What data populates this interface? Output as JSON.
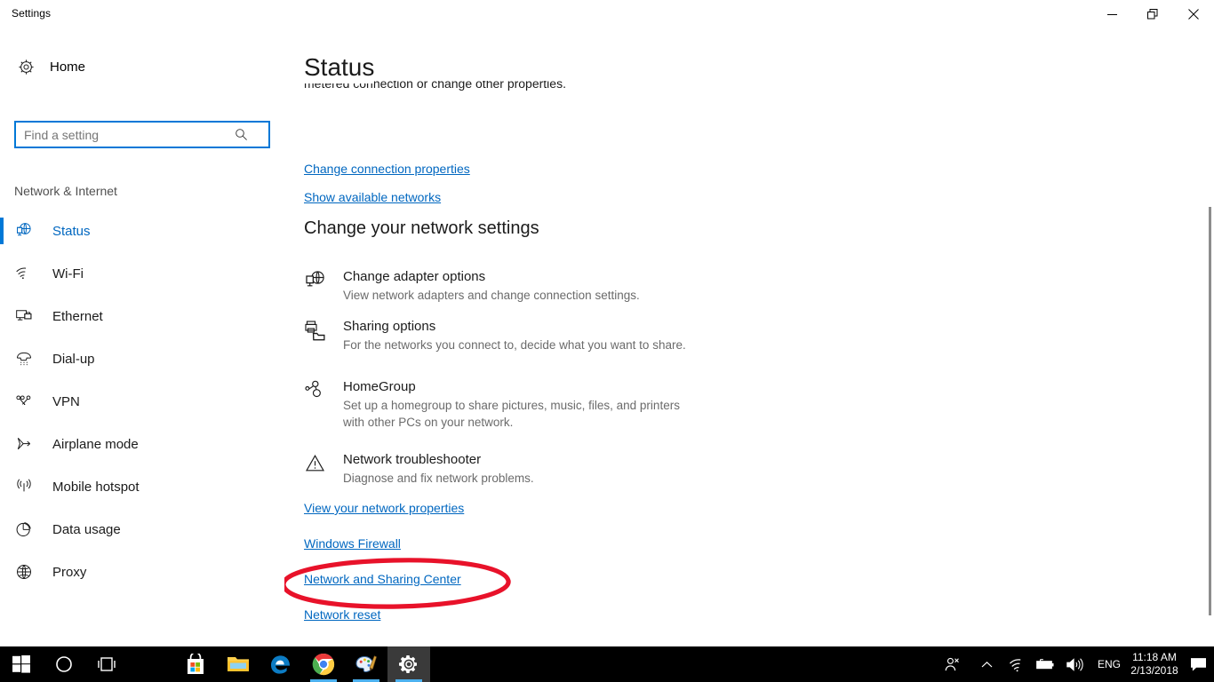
{
  "window": {
    "title": "Settings",
    "controls": {
      "minimize": "Minimize",
      "maximize": "Restore",
      "close": "Close"
    }
  },
  "sidebar": {
    "home_label": "Home",
    "home_icon": "gear-icon",
    "search": {
      "placeholder": "Find a setting",
      "value": "",
      "icon": "search-icon"
    },
    "category_label": "Network & Internet",
    "items": [
      {
        "label": "Status",
        "icon": "network-status-icon",
        "selected": true
      },
      {
        "label": "Wi-Fi",
        "icon": "wifi-icon",
        "selected": false
      },
      {
        "label": "Ethernet",
        "icon": "ethernet-icon",
        "selected": false
      },
      {
        "label": "Dial-up",
        "icon": "dialup-phone-icon",
        "selected": false
      },
      {
        "label": "VPN",
        "icon": "vpn-icon",
        "selected": false
      },
      {
        "label": "Airplane mode",
        "icon": "airplane-icon",
        "selected": false
      },
      {
        "label": "Mobile hotspot",
        "icon": "hotspot-icon",
        "selected": false
      },
      {
        "label": "Data usage",
        "icon": "pie-chart-icon",
        "selected": false
      },
      {
        "label": "Proxy",
        "icon": "globe-icon",
        "selected": false
      }
    ]
  },
  "content": {
    "page_title": "Status",
    "clipped_text": "metered connection or change other properties.",
    "top_links": [
      {
        "label": "Change connection properties"
      },
      {
        "label": "Show available networks"
      }
    ],
    "section_heading": "Change your network settings",
    "settings": [
      {
        "title": "Change adapter options",
        "description": "View network adapters and change connection settings.",
        "icon": "network-adapter-icon"
      },
      {
        "title": "Sharing options",
        "description": "For the networks you connect to, decide what you want to share.",
        "icon": "sharing-printer-folder-icon"
      },
      {
        "title": "HomeGroup",
        "description": "Set up a homegroup to share pictures, music, files, and printers with other PCs on your network.",
        "icon": "homegroup-icon"
      },
      {
        "title": "Network troubleshooter",
        "description": "Diagnose and fix network problems.",
        "icon": "warning-triangle-icon"
      }
    ],
    "bottom_links": [
      {
        "label": "View your network properties"
      },
      {
        "label": "Windows Firewall"
      },
      {
        "label": "Network and Sharing Center",
        "annotated": true
      },
      {
        "label": "Network reset"
      }
    ],
    "annotation": {
      "shape": "red-ellipse-highlight",
      "target": "Network and Sharing Center",
      "color": "#e8122a"
    }
  },
  "taskbar": {
    "items": [
      {
        "name": "start-button",
        "label": "Start",
        "running": false,
        "active": false
      },
      {
        "name": "cortana-button",
        "label": "Cortana",
        "running": false,
        "active": false
      },
      {
        "name": "task-view-button",
        "label": "Task View",
        "running": false,
        "active": false
      },
      {
        "name": "microsoft-store",
        "label": "Microsoft Store",
        "running": false,
        "active": false
      },
      {
        "name": "file-explorer",
        "label": "File Explorer",
        "running": false,
        "active": false
      },
      {
        "name": "microsoft-edge",
        "label": "Microsoft Edge",
        "running": false,
        "active": false
      },
      {
        "name": "google-chrome",
        "label": "Google Chrome",
        "running": true,
        "active": false
      },
      {
        "name": "paint",
        "label": "Paint",
        "running": true,
        "active": false
      },
      {
        "name": "settings",
        "label": "Settings",
        "running": true,
        "active": true
      }
    ],
    "tray": {
      "people_icon": "people-icon",
      "chevron_icon": "chevron-up-icon",
      "wifi_icon": "wifi-icon",
      "battery_icon": "battery-charging-icon",
      "volume_icon": "volume-icon",
      "language": "ENG",
      "time": "11:18 AM",
      "date": "2/13/2018",
      "action_center_icon": "action-center-icon"
    }
  },
  "colors": {
    "accent": "#0078d7",
    "link": "#0067c0",
    "annotation_red": "#e8122a",
    "taskbar_bg": "#000000",
    "running_underline": "#4cb1ef"
  }
}
